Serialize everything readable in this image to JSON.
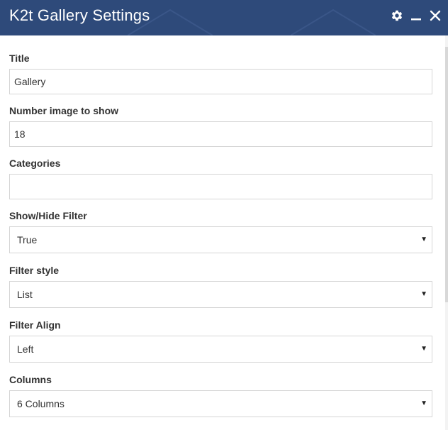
{
  "window": {
    "title": "K2t Gallery Settings",
    "header_color": "#2e4a7a",
    "icons": [
      "gear-icon",
      "minimize-icon",
      "close-icon"
    ]
  },
  "fields": {
    "title": {
      "label": "Title",
      "value": "Gallery"
    },
    "number_images": {
      "label": "Number image to show",
      "value": "18"
    },
    "categories": {
      "label": "Categories",
      "value": ""
    },
    "show_hide_filter": {
      "label": "Show/Hide Filter",
      "selected": "True"
    },
    "filter_style": {
      "label": "Filter style",
      "selected": "List"
    },
    "filter_align": {
      "label": "Filter Align",
      "selected": "Left"
    },
    "columns": {
      "label": "Columns",
      "selected": "6 Columns"
    }
  }
}
